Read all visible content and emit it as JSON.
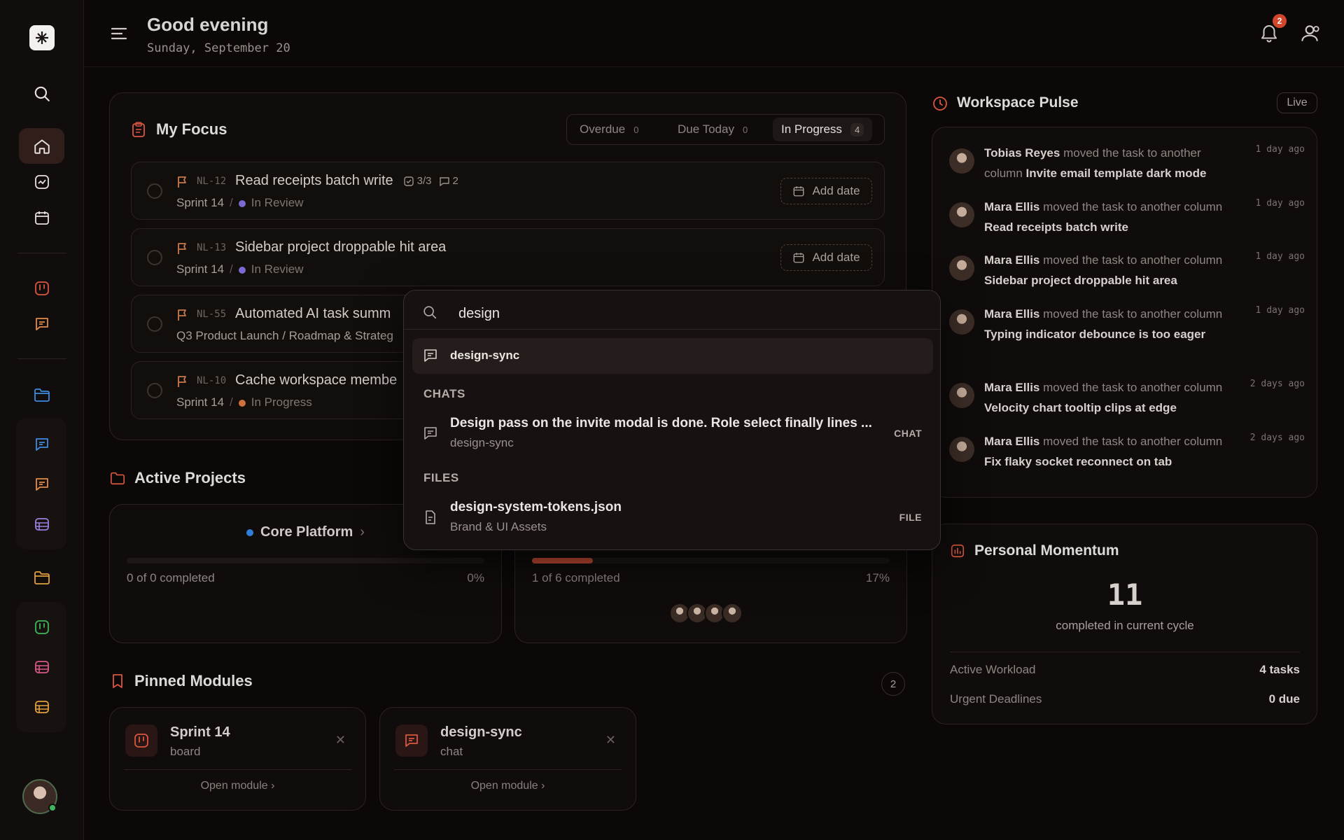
{
  "header": {
    "greeting": "Good evening",
    "date": "Sunday, September 20",
    "notifications_count": "2"
  },
  "sidebar": {
    "items": [
      "logo",
      "search",
      "home",
      "analytics",
      "calendar",
      "board",
      "chat",
      "folder",
      "chat",
      "chat",
      "table",
      "folder",
      "board",
      "table",
      "table"
    ],
    "accent": "#c5523a"
  },
  "focus": {
    "title": "My Focus",
    "filters": [
      {
        "label": "Overdue",
        "count": "0"
      },
      {
        "label": "Due Today",
        "count": "0"
      },
      {
        "label": "In Progress",
        "count": "4"
      }
    ],
    "tasks": [
      {
        "code": "NL-12",
        "title": "Read receipts batch write",
        "subtasks": "3/3",
        "comments": "2",
        "sprint": "Sprint 14",
        "status": "In Review",
        "status_color": "#7b6ad0",
        "add_date": "Add date"
      },
      {
        "code": "NL-13",
        "title": "Sidebar project droppable hit area",
        "sprint": "Sprint 14",
        "status": "In Review",
        "status_color": "#7b6ad0",
        "add_date": "Add date"
      },
      {
        "code": "NL-55",
        "title": "Automated AI task summ",
        "sprint": "Q3 Product Launch / Roadmap & Strateg"
      },
      {
        "code": "NL-10",
        "title": "Cache workspace membe",
        "sprint": "Sprint 14",
        "status": "In Progress",
        "status_color": "#d0703f"
      }
    ]
  },
  "projects": {
    "title": "Active Projects",
    "items": [
      {
        "name": "Core Platform",
        "dot_color": "#2f7fd6",
        "progress": 0,
        "completed": "0 of 0 completed",
        "percent": "0%"
      },
      {
        "progress": 0.17,
        "completed": "1 of 6 completed",
        "percent": "17%"
      }
    ]
  },
  "pinned": {
    "title": "Pinned Modules",
    "count": "2",
    "items": [
      {
        "name": "Sprint 14",
        "type": "board",
        "open": "Open module ›"
      },
      {
        "name": "design-sync",
        "type": "chat",
        "open": "Open module ›"
      }
    ]
  },
  "pulse": {
    "title": "Workspace Pulse",
    "live": "Live",
    "items": [
      {
        "user": "Tobias Reyes",
        "action": "moved the task to another column",
        "task": "Invite email template dark mode",
        "time": "1 day ago"
      },
      {
        "user": "Mara Ellis",
        "action": "moved the task to another column",
        "task": "Read receipts batch write",
        "time": "1 day ago"
      },
      {
        "user": "Mara Ellis",
        "action": "moved the task to another column",
        "task": "Sidebar project droppable hit area",
        "time": "1 day ago"
      },
      {
        "user": "Mara Ellis",
        "action": "moved the task to another column",
        "task": "Typing indicator debounce is too eager",
        "time": "1 day ago"
      },
      {
        "user": "Mara Ellis",
        "action": "moved the task to another column",
        "task": "Velocity chart tooltip clips at edge",
        "time": "2 days ago"
      },
      {
        "user": "Mara Ellis",
        "action": "moved the task to another column",
        "task": "Fix flaky socket reconnect on tab",
        "time": "2 days ago"
      }
    ]
  },
  "momentum": {
    "title": "Personal Momentum",
    "value": "11",
    "caption": "completed in current cycle",
    "rows": [
      {
        "label": "Active Workload",
        "value": "4 tasks"
      },
      {
        "label": "Urgent Deadlines",
        "value": "0 due"
      }
    ]
  },
  "search": {
    "query": "design",
    "top_result": "design-sync",
    "sections": {
      "chats": "CHATS",
      "files": "FILES"
    },
    "chat_result": {
      "title": "Design pass on the invite modal is done. Role select finally lines ...",
      "sub": "design-sync",
      "kind": "CHAT"
    },
    "file_result": {
      "title": "design-system-tokens.json",
      "sub": "Brand & UI Assets",
      "kind": "FILE"
    }
  }
}
